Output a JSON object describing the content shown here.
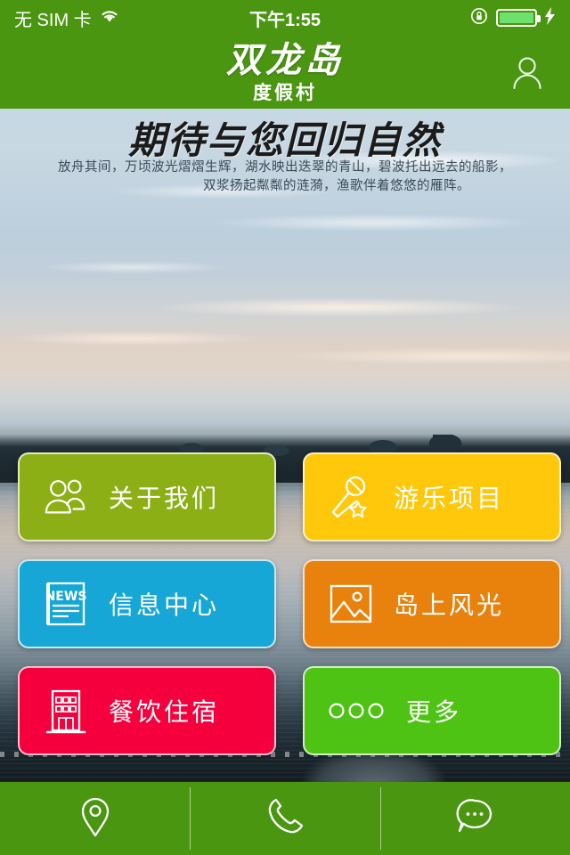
{
  "status_bar": {
    "carrier": "无 SIM 卡",
    "wifi_icon": "wifi-icon",
    "time": "下午1:55",
    "rotation_lock_icon": "rotation-lock-icon",
    "battery_icon": "battery-icon",
    "charging_icon": "lightning-bolt-icon"
  },
  "header": {
    "brand_main": "双龙岛",
    "brand_sub": "度假村",
    "account_icon": "user-account-icon",
    "bg_color": "#4a9611"
  },
  "banner": {
    "headline": "期待与您回归自然",
    "line1": "放舟其间，万顷波光熠熠生辉，湖水映出迭翠的青山，碧波托出远去的船影，",
    "line2": "双浆扬起粼粼的涟漪，渔歌伴着悠悠的雁阵。"
  },
  "tiles": [
    {
      "label": "关于我们",
      "icon": "two-people-icon",
      "color": "#8caf15"
    },
    {
      "label": "游乐项目",
      "icon": "microphone-star-icon",
      "color": "#ffc80a"
    },
    {
      "label": "信息中心",
      "icon": "news-paper-icon",
      "color": "#16a7d6"
    },
    {
      "label": "岛上风光",
      "icon": "photo-image-icon",
      "color": "#e8820c"
    },
    {
      "label": "餐饮住宿",
      "icon": "building-icon",
      "color": "#f5003c"
    },
    {
      "label": "更多",
      "icon": "three-circles-icon",
      "color": "#4ec314"
    }
  ],
  "bottom_nav": [
    {
      "icon": "location-pin-icon",
      "name": "location"
    },
    {
      "icon": "phone-icon",
      "name": "phone"
    },
    {
      "icon": "chat-bubble-icon",
      "name": "chat"
    }
  ]
}
